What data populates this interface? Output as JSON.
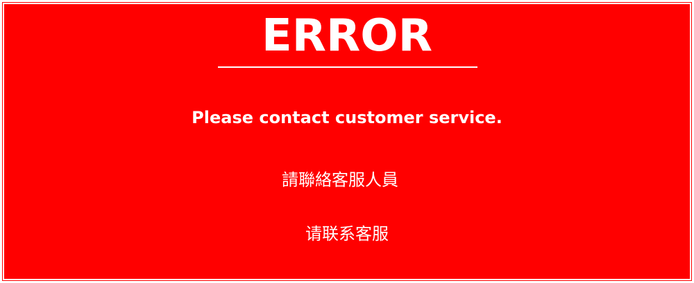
{
  "error": {
    "title": "ERROR",
    "message_en": "Please contact customer service.",
    "message_zh_traditional": "請聯絡客服人員",
    "message_zh_simplified": "请联系客服"
  },
  "colors": {
    "background": "#ff0000",
    "text": "#ffffff",
    "border": "#ffffff"
  }
}
